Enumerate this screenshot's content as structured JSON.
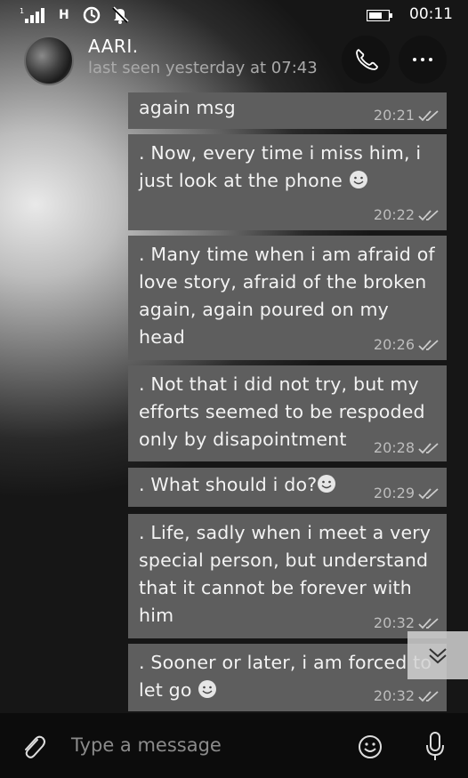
{
  "status_bar": {
    "network": "H",
    "time": "00:11"
  },
  "header": {
    "contact_name": "AARI.",
    "last_seen": "last seen yesterday at 07:43"
  },
  "messages": [
    {
      "text": "again msg",
      "time": "20:21"
    },
    {
      "text": ". Now, every time i miss him, i\njust look at the phone",
      "time": "20:22"
    },
    {
      "text": ". Many time when i am afraid of\nlove story, afraid of the broken\nagain, again poured on my\nhead",
      "time": "20:26"
    },
    {
      "text": ". Not that i did not try, but my\nefforts seemed to be respoded\nonly by disapointment",
      "time": "20:28"
    },
    {
      "text": ". What should i do?",
      "time": "20:29"
    },
    {
      "text": ". Life, sadly when i meet a very\nspecial person, but understand\nthat it cannot be forever with\nhim",
      "time": "20:32"
    },
    {
      "text": ". Sooner or later, i am forced to\nlet go",
      "time": "20:32"
    }
  ],
  "input": {
    "placeholder": "Type a message"
  },
  "icons": {
    "signal": "signal-icon",
    "sync": "sync-icon",
    "notifications_off": "bell-off-icon",
    "battery": "battery-icon",
    "call": "phone-icon",
    "more": "more-icon",
    "read": "double-check-icon",
    "scroll_down": "chevron-down-icon",
    "attach": "paperclip-icon",
    "emoji": "smiley-icon",
    "mic": "microphone-icon"
  }
}
